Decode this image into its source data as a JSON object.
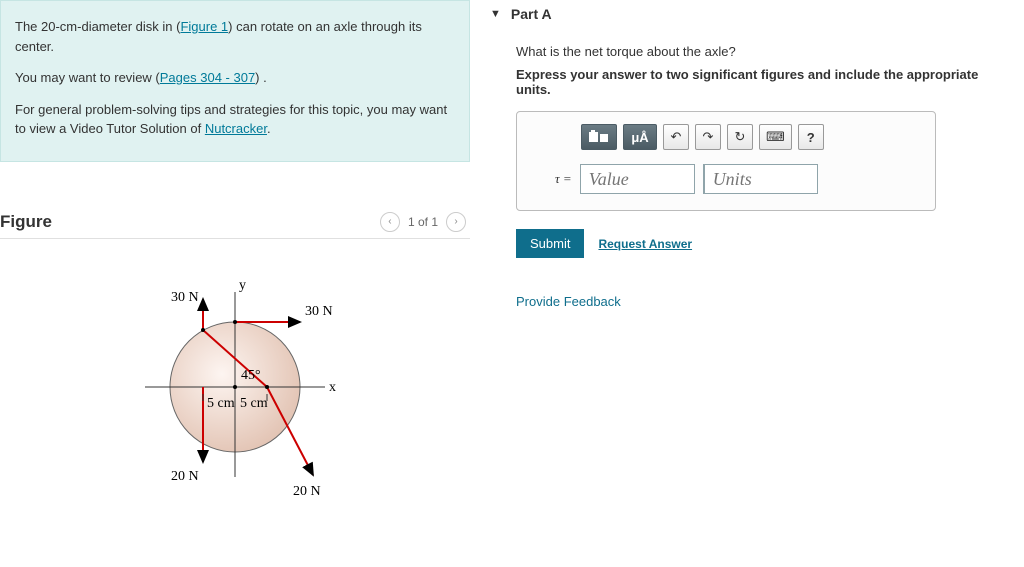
{
  "intro": {
    "p1_a": "The 20-cm-diameter disk in (",
    "p1_link": "Figure 1",
    "p1_b": ") can rotate on an axle through its center.",
    "p2_a": "You may want to review (",
    "p2_link": "Pages 304 - 307",
    "p2_b": ") .",
    "p3_a": "For general problem-solving tips and strategies for this topic, you may want to view a Video Tutor Solution of ",
    "p3_link": "Nutcracker",
    "p3_b": "."
  },
  "figure": {
    "title": "Figure",
    "pager": "1 of 1",
    "labels": {
      "y": "y",
      "x": "x",
      "f30_left": "30 N",
      "f30_right": "30 N",
      "f20_left": "20 N",
      "f20_right": "20 N",
      "d1": "5 cm",
      "d2": "5 cm",
      "angle": "45°"
    }
  },
  "partA": {
    "title": "Part A",
    "question": "What is the net torque about the axle?",
    "instruction": "Express your answer to two significant figures and include the appropriate units.",
    "toolbar": {
      "templates": "□",
      "greek": "μÅ",
      "undo": "↶",
      "redo": "↷",
      "reset": "↻",
      "keyboard": "⌨",
      "help": "?"
    },
    "tau_label": "τ =",
    "value_placeholder": "Value",
    "units_placeholder": "Units",
    "submit": "Submit",
    "request": "Request Answer"
  },
  "feedback": "Provide Feedback"
}
